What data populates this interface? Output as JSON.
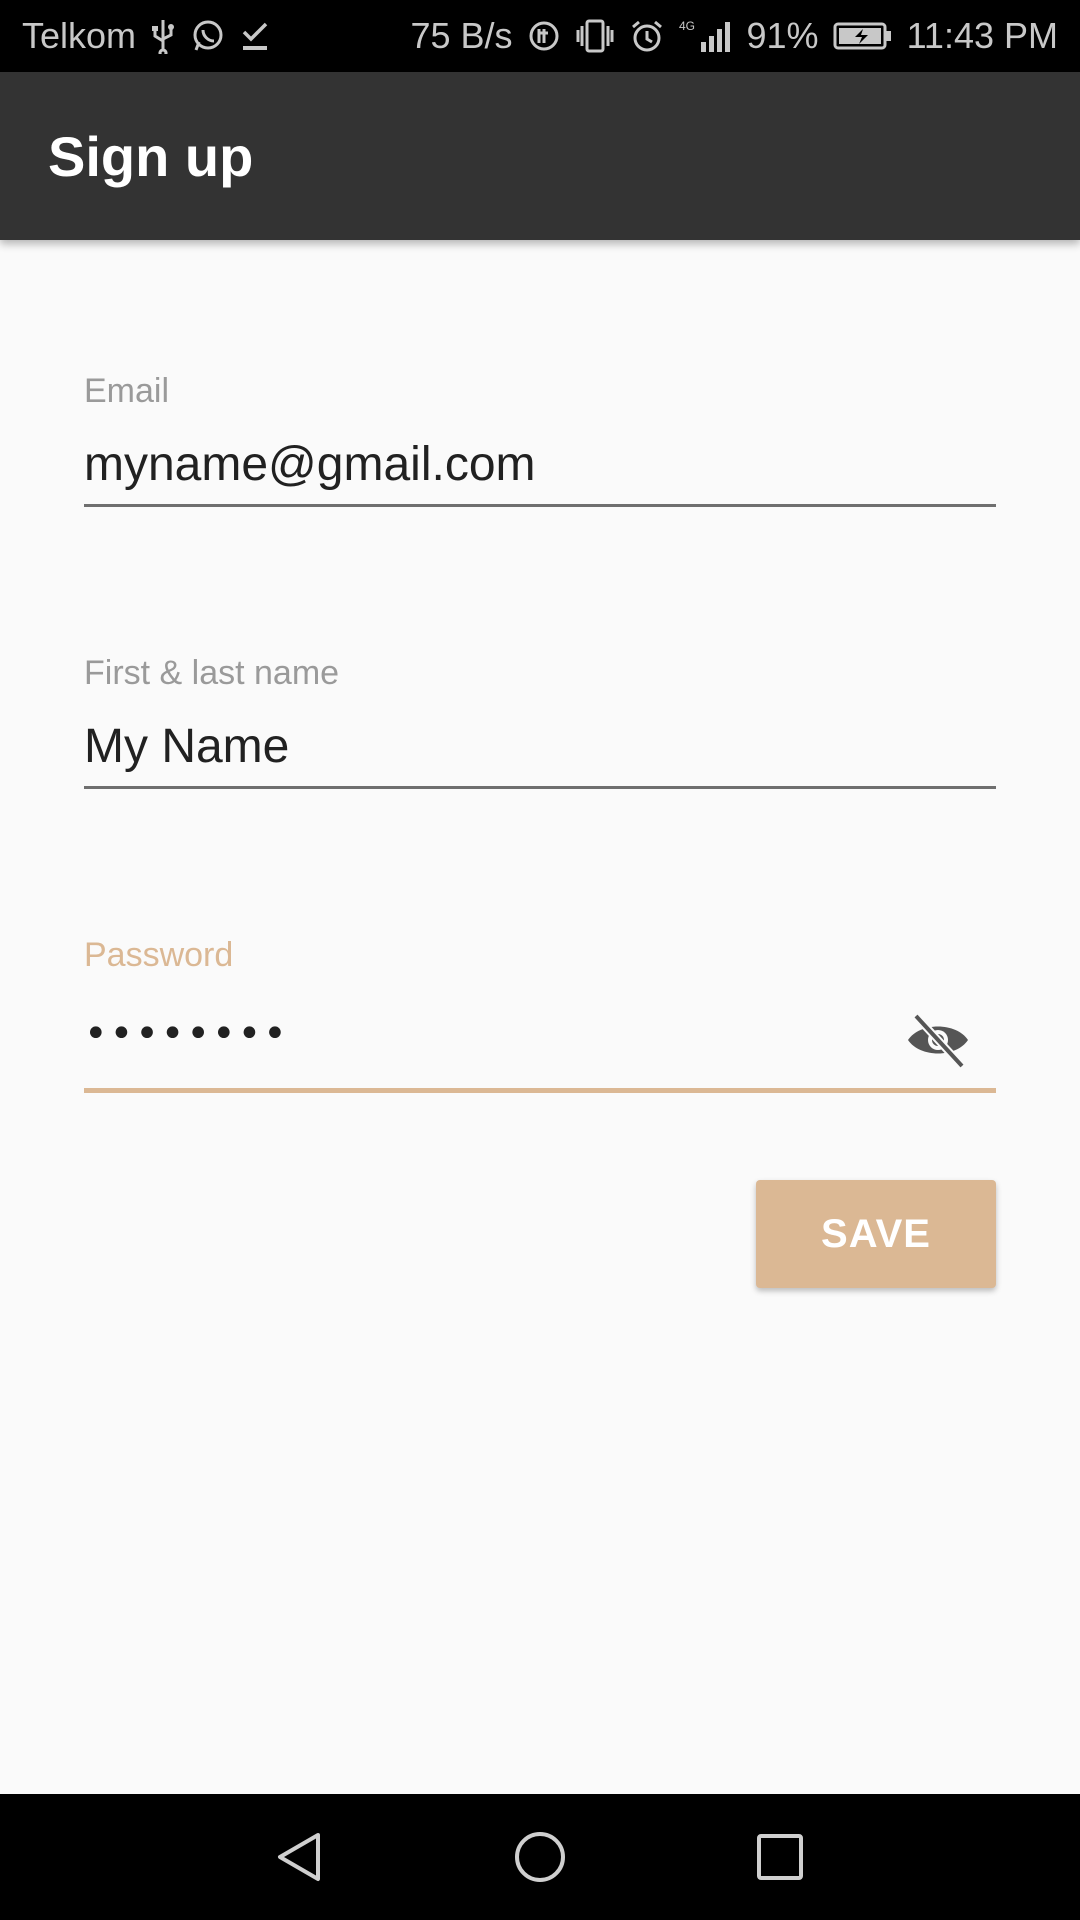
{
  "status_bar": {
    "carrier": "Telkom",
    "net_speed": "75 B/s",
    "network_type": "4G",
    "battery": "91%",
    "time": "11:43 PM",
    "left_icons": [
      "usb-icon",
      "whatsapp-icon",
      "download-done-icon"
    ],
    "right_icons": [
      "data-saver-icon",
      "vibrate-icon",
      "alarm-icon",
      "signal-icon",
      "battery-charging-icon"
    ]
  },
  "app_bar": {
    "title": "Sign up"
  },
  "form": {
    "email": {
      "label": "Email",
      "value": "myname@gmail.com"
    },
    "name": {
      "label": "First & last name",
      "value": "My Name"
    },
    "password": {
      "label": "Password",
      "value": "••••••••",
      "toggle_icon": "visibility-off-icon",
      "focused": true
    },
    "save_label": "SAVE"
  },
  "colors": {
    "accent": "#dbb894",
    "app_bar": "#333333",
    "background": "#fafafa",
    "status_bar": "#000000"
  },
  "nav_bar": {
    "icons": [
      "back-icon",
      "home-icon",
      "recents-icon"
    ]
  }
}
